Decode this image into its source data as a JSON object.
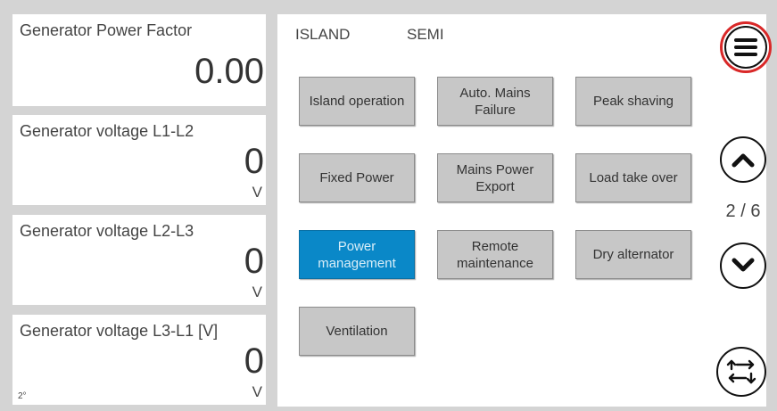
{
  "measurements": [
    {
      "label": "Generator Power Factor",
      "value": "0.00",
      "unit": "",
      "corner": ""
    },
    {
      "label": "Generator voltage L1-L2",
      "value": "0",
      "unit": "V",
      "corner": ""
    },
    {
      "label": "Generator voltage L2-L3",
      "value": "0",
      "unit": "V",
      "corner": ""
    },
    {
      "label": "Generator voltage L3-L1 [V]",
      "value": "0",
      "unit": "V",
      "corner": "2°"
    }
  ],
  "status": {
    "left": "ISLAND",
    "right": "SEMI"
  },
  "modes": [
    {
      "label": "Island operation",
      "active": false
    },
    {
      "label": "Auto. Mains Failure",
      "active": false
    },
    {
      "label": "Peak shaving",
      "active": false
    },
    {
      "label": "Fixed Power",
      "active": false
    },
    {
      "label": "Mains Power Export",
      "active": false
    },
    {
      "label": "Load take over",
      "active": false
    },
    {
      "label": "Power management",
      "active": true
    },
    {
      "label": "Remote maintenance",
      "active": false
    },
    {
      "label": "Dry alternator",
      "active": false
    },
    {
      "label": "Ventilation",
      "active": false
    }
  ],
  "pager": {
    "text": "2 / 6"
  },
  "icons": {
    "menu": "hamburger-menu-icon",
    "up": "chevron-up-icon",
    "down": "chevron-down-icon",
    "swap": "swap-arrows-icon"
  },
  "colors": {
    "active_mode": "#0a88c8",
    "menu_highlight": "#d92828",
    "button": "#c7c7c7"
  }
}
